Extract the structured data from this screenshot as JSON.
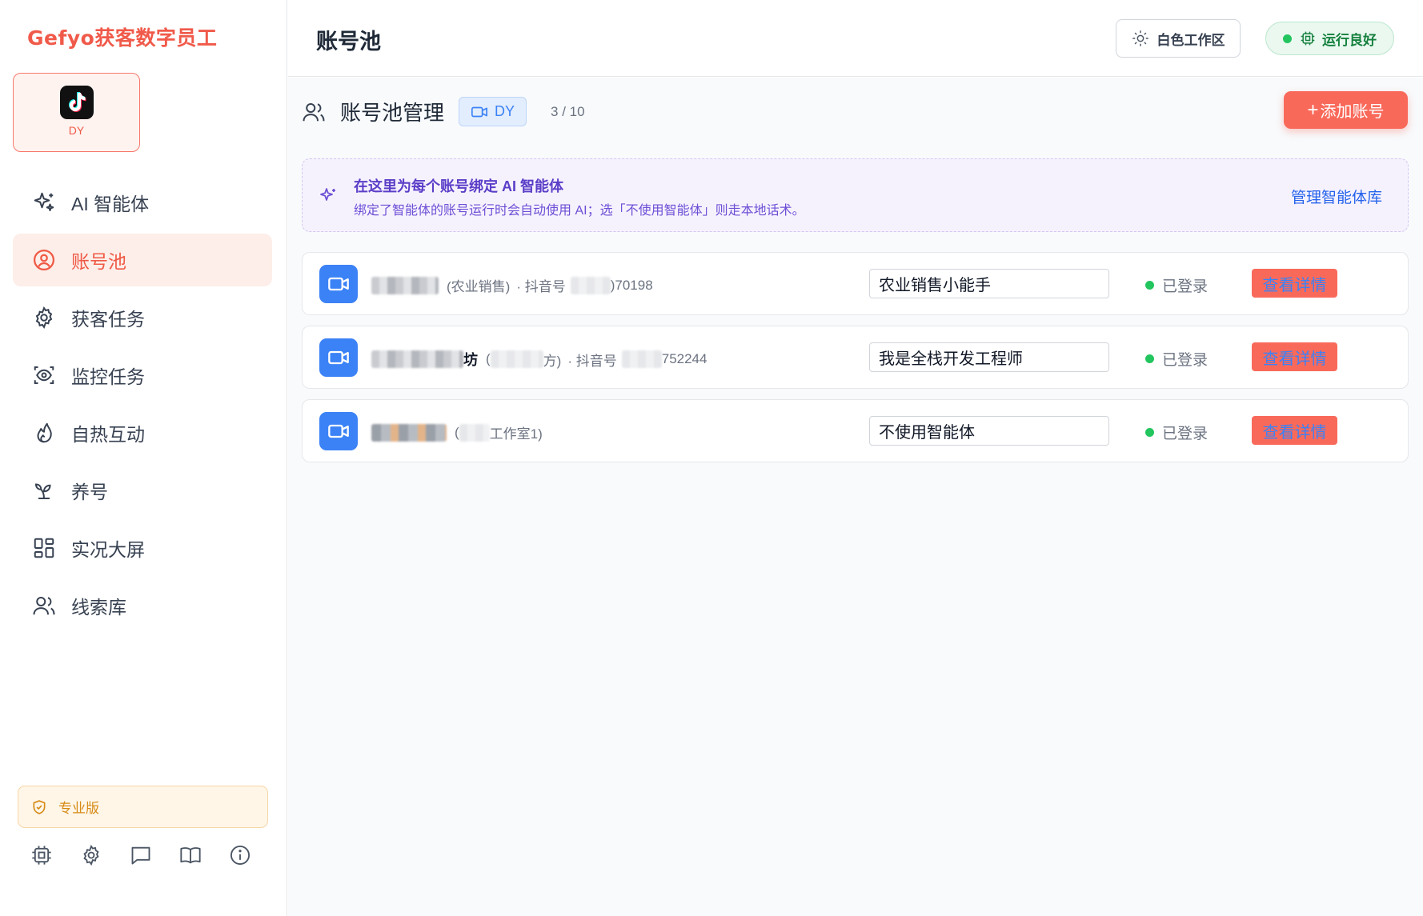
{
  "app": {
    "brand": "Gefyo获客数字员工"
  },
  "platform_card": {
    "label": "DY",
    "icon": "tiktok-logo-icon"
  },
  "sidebar": {
    "items": [
      {
        "label": "AI 智能体",
        "icon": "sparkles-icon",
        "active": false
      },
      {
        "label": "账号池",
        "icon": "user-circle-icon",
        "active": true
      },
      {
        "label": "获客任务",
        "icon": "gear-icon",
        "active": false
      },
      {
        "label": "监控任务",
        "icon": "scan-eye-icon",
        "active": false
      },
      {
        "label": "自热互动",
        "icon": "flame-icon",
        "active": false
      },
      {
        "label": "养号",
        "icon": "sprout-icon",
        "active": false
      },
      {
        "label": "实况大屏",
        "icon": "dashboard-grid-icon",
        "active": false
      },
      {
        "label": "线索库",
        "icon": "users-icon",
        "active": false
      }
    ],
    "plan_label": "专业版",
    "bottom_icons": [
      "cpu-icon",
      "settings-icon",
      "message-icon",
      "book-icon",
      "info-icon"
    ]
  },
  "header": {
    "title": "账号池",
    "workspace_label": "白色工作区",
    "status_label": "运行良好"
  },
  "main": {
    "section_title": "账号池管理",
    "platform_chip": "DY",
    "count": "3 / 10",
    "add_button": "添加账号",
    "add_plus": "+",
    "banner": {
      "title": "在这里为每个账号绑定 AI 智能体",
      "desc": "绑定了智能体的账号运行时会自动使用 AI；选「不使用智能体」则走本地话术。",
      "link": "管理智能体库"
    },
    "accounts": [
      {
        "name_suffix": "",
        "note_open": "(农业销售)",
        "douyin_label": "· 抖音号",
        "douyin_suffix": ")70198",
        "agent": "农业销售小能手",
        "status": "已登录",
        "action": "查看详情"
      },
      {
        "name_suffix": "坊",
        "note_open": "(",
        "note_close": "方)",
        "douyin_label": "· 抖音号",
        "douyin_suffix": "752244",
        "agent": "我是全栈开发工程师",
        "status": "已登录",
        "action": "查看详情"
      },
      {
        "name_suffix": "",
        "note_open": "(",
        "note_close": "工作室1)",
        "douyin_label": "",
        "douyin_suffix": "",
        "agent": "不使用智能体",
        "status": "已登录",
        "action": "查看详情"
      }
    ]
  },
  "colors": {
    "accent": "#f9695a",
    "brand": "#f05a4a",
    "status_green": "#22c55e",
    "link_blue": "#2563eb",
    "banner_purple": "#5b3ec8"
  }
}
